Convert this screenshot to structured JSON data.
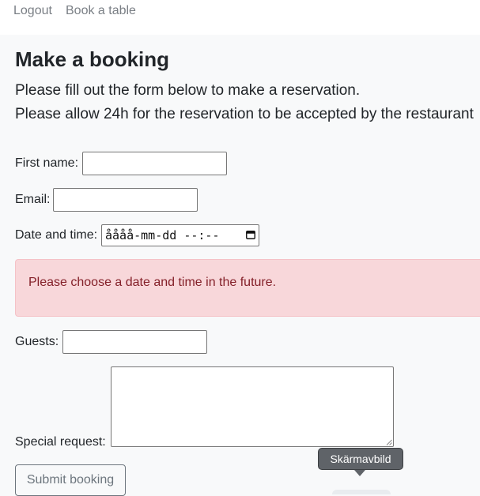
{
  "nav": {
    "logout_label": "Logout",
    "book_label": "Book a table"
  },
  "page": {
    "title": "Make a booking",
    "intro_line_1": "Please fill out the form below to make a reservation.",
    "intro_line_2": "Please allow 24h for the reservation to be accepted by the restaurant"
  },
  "form": {
    "first_name_label": "First name:",
    "first_name_value": "",
    "email_label": "Email:",
    "email_value": "",
    "datetime_label": "Date and time:",
    "datetime_value": "åååå-mm-dd --:--",
    "error_message": "Please choose a date and time in the future.",
    "guests_label": "Guests:",
    "guests_value": "",
    "special_request_label": "Special request:",
    "special_request_value": "",
    "submit_label": "Submit booking"
  },
  "tooltip": {
    "text": "Skärmavbild"
  },
  "icons": {
    "datetime_picker": "calendar-icon",
    "textarea_resize": "resize-grip-icon"
  },
  "colors": {
    "page_background": "#f8f9fa",
    "error_background": "#f8d7da",
    "error_text": "#842029",
    "button_outline": "#6c757d",
    "tooltip_background": "#5f6368"
  }
}
